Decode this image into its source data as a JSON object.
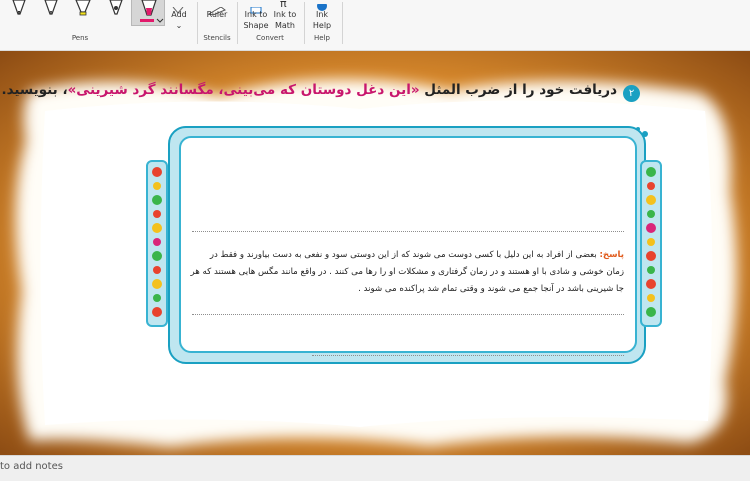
{
  "ribbon": {
    "pens_group": "Pens",
    "add_label": "Add",
    "ruler_label": "Ruler",
    "stencils_group": "Stencils",
    "ink_to_shape": [
      "Ink to",
      "Shape"
    ],
    "ink_to_math": [
      "Ink to",
      "Math"
    ],
    "convert_group": "Convert",
    "ink_help": [
      "Ink",
      "Help"
    ],
    "help_group": "Help"
  },
  "page": {
    "question_number": "۲",
    "title_start": "دریافت خود را از ضرب المثل ",
    "title_quote": "«این دغل دوستان که می‌بینی، مگسانند گرد شیرینی»",
    "title_end": "، بنویسید.",
    "answer_label": "پاسخ:",
    "answer_text": "بعضی از افراد به این دلیل با کسی دوست می شوند که از این دوستی سود و نفعی به دست بیاورند و فقط در زمان خوشی و شادی با او هستند و در زمان گرفتاری و مشکلات او را رها می کنند . در واقع مانند مگس هایی هستند که هر جا شیرینی باشد در آنجا جمع می شوند و وقتی تمام شد پراکنده می شوند ."
  },
  "status_bar": {
    "text": "to add notes"
  },
  "colors": {
    "accent": "#1aa0c2",
    "quote": "#c8166d",
    "answer_label": "#e05a1b",
    "frame_fill": "#bfe6f0"
  }
}
